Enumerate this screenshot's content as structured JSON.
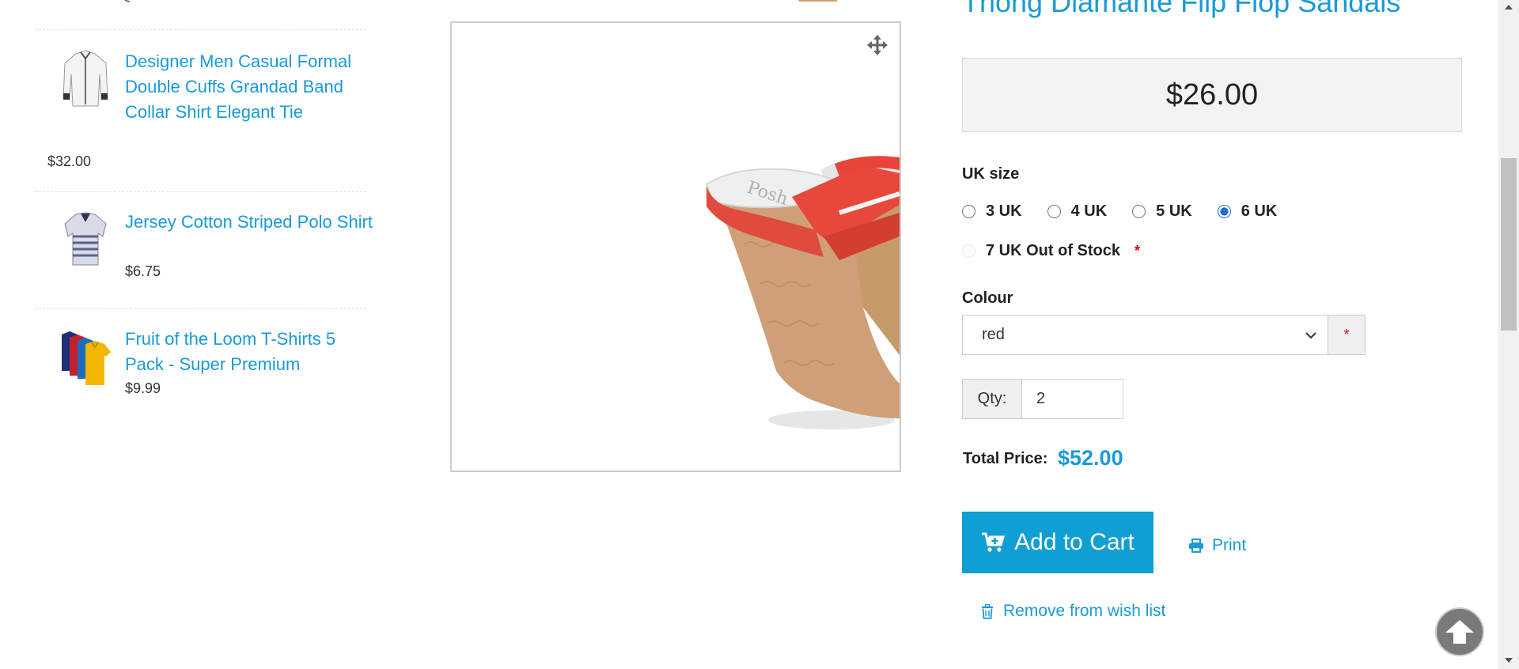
{
  "sidebar": {
    "items": [
      {
        "title": "Designer Men Casual Formal Double Cuffs Grandad Band Collar Shirt Elegant Tie",
        "price": "$32.00"
      },
      {
        "title": "Jersey Cotton Striped Polo Shirt",
        "price": "$6.75"
      },
      {
        "title": "Fruit of the Loom T-Shirts 5 Pack - Super Premium",
        "price": "$9.99"
      }
    ]
  },
  "product": {
    "title": "Thong Diamante Flip Flop Sandals",
    "price": "$26.00",
    "size_label": "UK size",
    "sizes": [
      {
        "label": "3 UK",
        "checked": false,
        "disabled": false
      },
      {
        "label": "4 UK",
        "checked": false,
        "disabled": false
      },
      {
        "label": "5 UK",
        "checked": false,
        "disabled": false
      },
      {
        "label": "6 UK",
        "checked": true,
        "disabled": false
      },
      {
        "label": "7 UK Out of Stock",
        "checked": false,
        "disabled": true
      }
    ],
    "required_mark": "*",
    "colour_label": "Colour",
    "colour_value": "red",
    "qty_label": "Qty:",
    "qty_value": "2",
    "total_label": "Total Price:",
    "total_value": "$52.00",
    "add_to_cart": "Add to Cart",
    "print": "Print",
    "remove_wishlist": "Remove from wish list"
  },
  "colors": {
    "link": "#1a9ad6",
    "button": "#0f9fd4",
    "required": "#d0021b"
  },
  "icons": [
    "move-icon",
    "cart-icon",
    "printer-icon",
    "trash-icon",
    "scroll-top-icon",
    "chevron-down-icon"
  ]
}
